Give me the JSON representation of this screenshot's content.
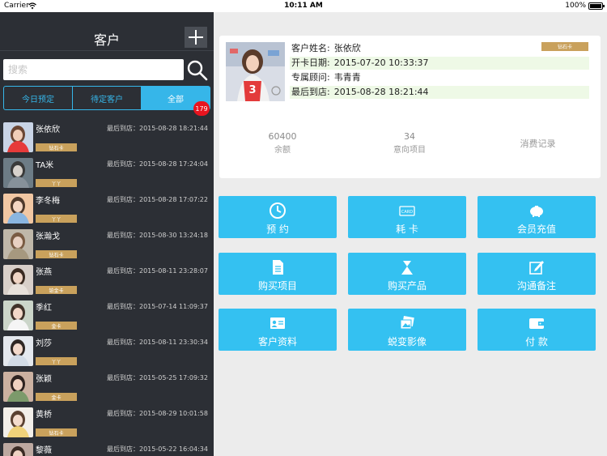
{
  "status_bar": {
    "carrier": "Carrier",
    "time": "10:11 AM",
    "battery": "100%",
    "battery_level": 1.0
  },
  "sidebar": {
    "title": "客户",
    "search": {
      "placeholder": "搜索",
      "value": ""
    },
    "segments": [
      {
        "label": "今日预定",
        "active": false
      },
      {
        "label": "待定客户",
        "active": false
      },
      {
        "label": "全部",
        "active": true
      }
    ],
    "count_badge": "179",
    "customers": [
      {
        "name": "张依欣",
        "badge": "钻石卡",
        "last_visit": "最后到店：2015-08-28 18:21:44"
      },
      {
        "name": "TA米",
        "badge": "丫丫",
        "last_visit": "最后到店：2015-08-28 17:24:04"
      },
      {
        "name": "李冬梅",
        "badge": "丫丫",
        "last_visit": "最后到店：2015-08-28 17:07:22"
      },
      {
        "name": "张瀚戈",
        "badge": "钻石卡",
        "last_visit": "最后到店：2015-08-30 13:24:18"
      },
      {
        "name": "张燕",
        "badge": "铂金卡",
        "last_visit": "最后到店：2015-08-11 23:28:07"
      },
      {
        "name": "季红",
        "badge": "金卡",
        "last_visit": "最后到店：2015-07-14 11:09:37"
      },
      {
        "name": "刘莎",
        "badge": "丫丫",
        "last_visit": "最后到店：2015-08-11 23:30:34"
      },
      {
        "name": "张颖",
        "badge": "金卡",
        "last_visit": "最后到店：2015-05-25 17:09:32"
      },
      {
        "name": "黄桥",
        "badge": "钻石卡",
        "last_visit": "最后到店：2015-08-29 10:01:58"
      },
      {
        "name": "黎薇",
        "badge": "",
        "last_visit": "最后到店：2015-05-22 16:04:34"
      }
    ]
  },
  "detail": {
    "tier": "钻石卡",
    "fields": [
      {
        "label": "客户姓名:",
        "value": "张依欣"
      },
      {
        "label": "开卡日期:",
        "value": "2015-07-20 10:33:37"
      },
      {
        "label": "专属顾问:",
        "value": "韦青青"
      },
      {
        "label": "最后到店:",
        "value": "2015-08-28 18:21:44"
      }
    ],
    "stats": [
      {
        "value": "60400",
        "label": "余额"
      },
      {
        "value": "34",
        "label": "意向项目"
      }
    ],
    "records_link": "消费记录"
  },
  "actions": [
    {
      "label": "预 约",
      "icon": "clock-icon"
    },
    {
      "label": "耗 卡",
      "icon": "card-icon"
    },
    {
      "label": "会员充值",
      "icon": "piggy-bank-icon"
    },
    {
      "label": "购买项目",
      "icon": "document-icon"
    },
    {
      "label": "购买产品",
      "icon": "product-icon"
    },
    {
      "label": "沟通备注",
      "icon": "edit-icon"
    },
    {
      "label": "客户资料",
      "icon": "id-card-icon"
    },
    {
      "label": "蜕变影像",
      "icon": "photos-icon"
    },
    {
      "label": "付 款",
      "icon": "wallet-icon"
    }
  ],
  "colors": {
    "accent": "#34c1f1",
    "sidebar_bg": "#2c2f35",
    "badge_gold": "#c9a15c",
    "alert_red": "#e8141f",
    "row_highlight": "#eef9e6"
  }
}
